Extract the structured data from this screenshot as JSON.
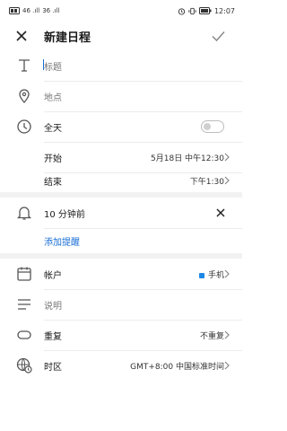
{
  "status_bar": {
    "time": "12:07",
    "signal_left": "46 .ıll",
    "signal_right": "36 .ıll",
    "battery_icon": "battery-icon"
  },
  "header": {
    "title": "新建日程",
    "close_icon": "close-icon",
    "confirm_icon": "checkmark-icon"
  },
  "fields": {
    "title_placeholder": "标题",
    "location_placeholder": "地点",
    "all_day_label": "全天",
    "start_label": "开始",
    "start_value": "5月18日 中午12:30",
    "end_label": "结束",
    "end_value": "下午1:30",
    "reminder_label": "10 分钟前",
    "add_reminder": "添加提醒",
    "account_label": "帐户",
    "account_value": "手机",
    "description_placeholder": "说明",
    "repeat_label": "重复",
    "repeat_value": "不重复",
    "timezone_label": "时区",
    "timezone_value": "GMT+8:00 中国标准时间"
  },
  "colors": {
    "accent": "#1a6fd6",
    "account_dot": "#1e88e5",
    "section_bg": "#f2f2f2"
  }
}
